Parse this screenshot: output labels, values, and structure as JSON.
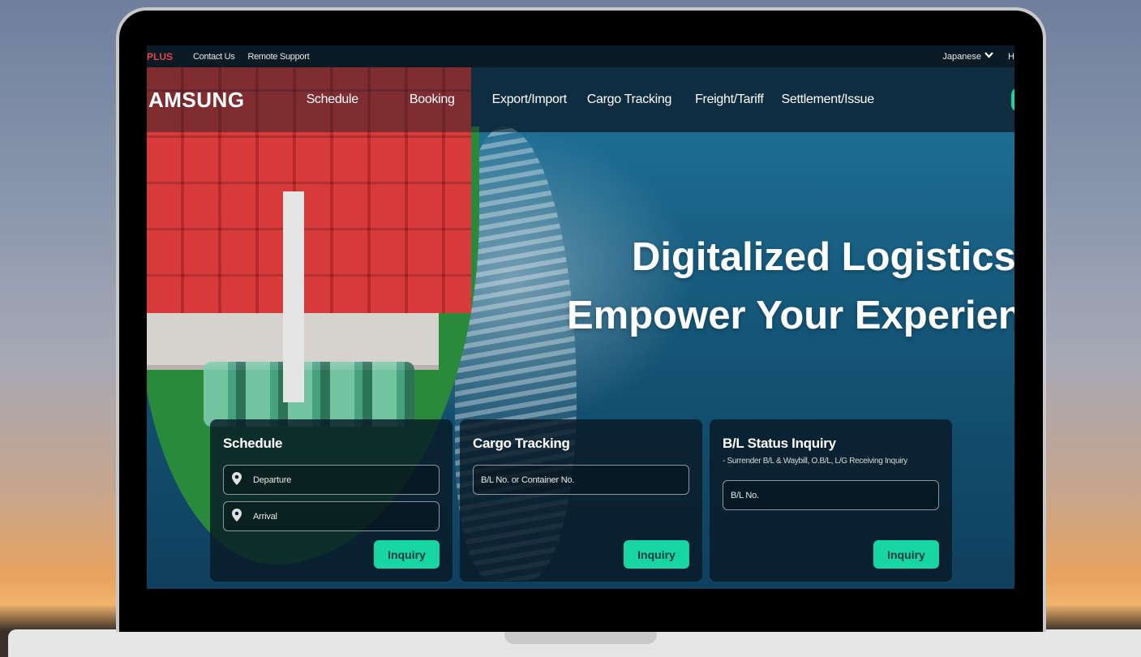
{
  "topbar": {
    "brand": "PLUS",
    "links": [
      "Contact Us",
      "Remote Support"
    ],
    "language": "Japanese",
    "cut_text": "H"
  },
  "nav": {
    "logo": "AMSUNG",
    "items": [
      "Schedule",
      "Booking",
      "Export/Import",
      "Cargo Tracking",
      "Freight/Tariff",
      "Settlement/Issue"
    ]
  },
  "hero": {
    "line1": "Digitalized Logistics",
    "line2": "Empower Your Experien"
  },
  "cards": {
    "schedule": {
      "title": "Schedule",
      "departure": "Departure",
      "arrival": "Arrival",
      "button": "Inquiry"
    },
    "cargo": {
      "title": "Cargo Tracking",
      "placeholder": "B/L No. or Container No.",
      "button": "Inquiry"
    },
    "bl": {
      "title": "B/L Status Inquiry",
      "subtitle": "- Surrender B/L & Waybill, O.B/L, L/G Receiving Inquiry",
      "placeholder": "B/L No.",
      "button": "Inquiry"
    }
  },
  "colors": {
    "accent": "#17d6a4",
    "brand_red": "#e24646",
    "topbar_bg": "#0b1a24"
  },
  "icons": {
    "location": "map-pin-icon",
    "chevron": "chevron-down-icon"
  }
}
